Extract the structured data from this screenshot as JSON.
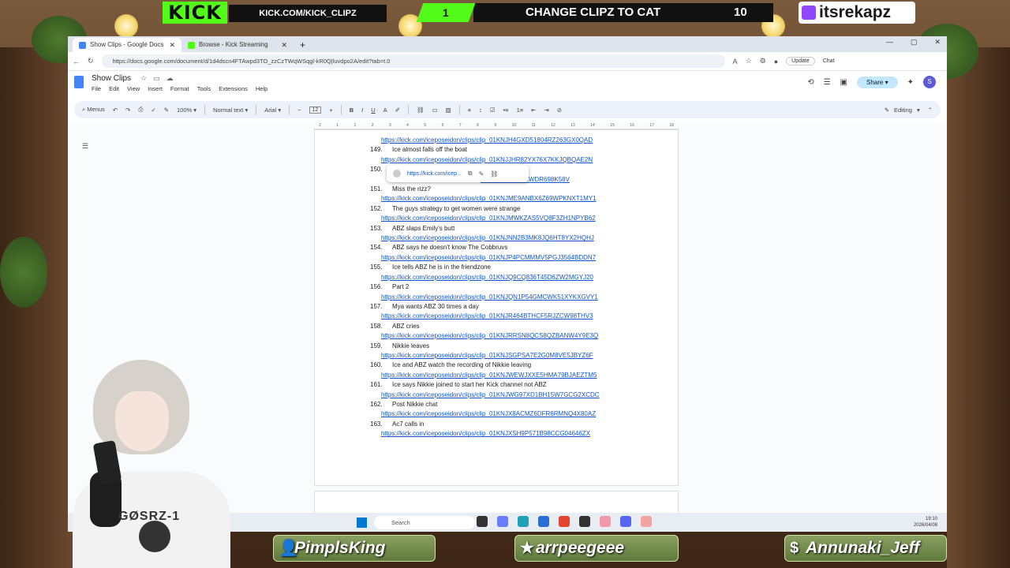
{
  "overlay": {
    "kick_logo": "KICK",
    "kick_url": "KICK.COM/KICK_CLIPZ",
    "badge_count": "1",
    "goal_text": "CHANGE CLIPZ TO CAT",
    "goal_count": "10",
    "twitch_handle": "itsrekapz",
    "shirt_text": "GØSRZ-1",
    "subs": [
      {
        "name": "PimplsKing",
        "icon": "person-icon"
      },
      {
        "name": "arrpeegeee",
        "icon": "star-icon"
      },
      {
        "name": "Annunaki_Jeff",
        "icon": "dollar-icon"
      }
    ],
    "colors": {
      "kick_green": "#53fc18",
      "twitch_purple": "#9146ff",
      "link_blue": "#1155cc"
    }
  },
  "browser": {
    "tabs": [
      {
        "label": "Show Clips - Google Docs",
        "active": true
      },
      {
        "label": "Browse - Kick Streaming",
        "active": false
      }
    ],
    "new_tab": "+",
    "url": "https://docs.google.com/document/d/1d4dscn4FTAwpd3TO_zzCzTWqWSqgl-kR0Q|luvdpo2A/edit?tab=t.0",
    "update_label": "Update",
    "chat_label": "Chat"
  },
  "docs": {
    "title": "Show Clips",
    "menu": [
      "File",
      "Edit",
      "View",
      "Insert",
      "Format",
      "Tools",
      "Extensions",
      "Help"
    ],
    "share_label": "Share",
    "avatar_letter": "S",
    "toolbar": {
      "menus": "Menus",
      "zoom": "100%",
      "style": "Normal text",
      "font": "Arial",
      "font_size": "12",
      "editing": "Editing"
    },
    "ruler": [
      "2",
      "1",
      "1",
      "2",
      "3",
      "4",
      "5",
      "6",
      "7",
      "8",
      "9",
      "10",
      "11",
      "12",
      "13",
      "14",
      "15",
      "16",
      "17",
      "18"
    ],
    "top_link": "https://kick.com/iceposeidon/clips/clip_01KNJH4GXD51804RZ263GX0QAD",
    "link_popup": {
      "url": "https://kick.com/icep..."
    },
    "entries": [
      {
        "num": "149.",
        "title": "Ice almost falls off the boat",
        "link": "https://kick.com/iceposeidon/clips/clip_01KNJJHR82YX76X7KKJQBQAE2N"
      },
      {
        "num": "150.",
        "title": "",
        "link": "M7H3TVBG1WNWDR698K58V"
      },
      {
        "num": "151.",
        "title": "Miss the rizz?",
        "link": "https://kick.com/iceposeidon/clips/clip_01KNJME9ANBX6Z69WPKNXT1MY1"
      },
      {
        "num": "152.",
        "title": "The guys strategy to get women were strange",
        "link": "https://kick.com/iceposeidon/clips/clip_01KNJMWKZAS5VQ8F3ZH1NPYB62"
      },
      {
        "num": "153.",
        "title": "ABZ slaps Emily's butt",
        "link": "https://kick.com/iceposeidon/clips/clip_01KNJNN2B3MK8JQ6HT8YX2HQHJ"
      },
      {
        "num": "154.",
        "title": "ABZ says he doesn't know The Cobbruvs",
        "link": "https://kick.com/iceposeidon/clips/clip_01KNJP4PCMMMV5PGJ3564BDDN7"
      },
      {
        "num": "155.",
        "title": "Ice tells ABZ he is in the friendzone",
        "link": "https://kick.com/iceposeidon/clips/clip_01KNJQ9CQ836T45D6ZW2MGYJ20"
      },
      {
        "num": "156.",
        "title": "Part 2",
        "link": "https://kick.com/iceposeidon/clips/clip_01KNJQN1P54GMCWK51XYKXGVY1"
      },
      {
        "num": "157.",
        "title": "Mya wants ABZ 30 times a day",
        "link": "https://kick.com/iceposeidon/clips/clip_01KNJR464BTHCF5RJZCW98THV3"
      },
      {
        "num": "158.",
        "title": "ABZ cries",
        "link": "https://kick.com/iceposeidon/clips/clip_01KNJRRSN8QCS8QZBANW4Y9E3Q"
      },
      {
        "num": "159.",
        "title": "Nikkie leaves",
        "link": "https://kick.com/iceposeidon/clips/clip_01KNJSGPSA7E2G0M8VE5JBYZ6F"
      },
      {
        "num": "160.",
        "title": "Ice and ABZ watch the recording of Nikkie leaving",
        "link": "https://kick.com/iceposeidon/clips/clip_01KNJWEWJXXE5HMA79BJAEZTM5"
      },
      {
        "num": "161.",
        "title": "Ice says Nikkie joined to start her Kick channel not ABZ",
        "link": "https://kick.com/iceposeidon/clips/clip_01KNJWG97XD1BH15W7GCG2XCDC"
      },
      {
        "num": "162.",
        "title": "Post Nikkie chat",
        "link": "https://kick.com/iceposeidon/clips/clip_01KNJX8ACMZ6DFR6RMNQ4X80AZ"
      },
      {
        "num": "163.",
        "title": "Ac7 calls in",
        "link": "https://kick.com/iceposeidon/clips/clip_01KNJXSH9P571B98CCG04646ZX"
      }
    ]
  },
  "taskbar": {
    "search_placeholder": "Search",
    "time": "19:10",
    "date": "2026/04/08"
  }
}
